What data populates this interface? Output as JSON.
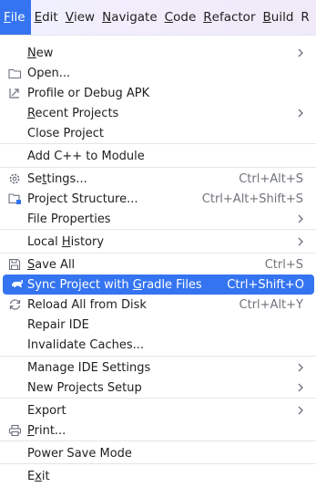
{
  "menubar": {
    "items": [
      {
        "pre": "",
        "ul": "F",
        "post": "ile"
      },
      {
        "pre": "",
        "ul": "E",
        "post": "dit"
      },
      {
        "pre": "",
        "ul": "V",
        "post": "iew"
      },
      {
        "pre": "",
        "ul": "N",
        "post": "avigate"
      },
      {
        "pre": "",
        "ul": "C",
        "post": "ode"
      },
      {
        "pre": "",
        "ul": "R",
        "post": "efactor"
      },
      {
        "pre": "",
        "ul": "B",
        "post": "uild"
      },
      {
        "pre": "",
        "ul": "R",
        "post": ""
      }
    ]
  },
  "file_menu": {
    "new": {
      "pre": "",
      "ul": "N",
      "post": "ew"
    },
    "open": {
      "pre": "",
      "ul": "",
      "post": "Open..."
    },
    "profile_debug": {
      "pre": "Profile or Debug APK",
      "ul": "",
      "post": ""
    },
    "recent_projects": {
      "pre": "",
      "ul": "R",
      "post": "ecent Projects"
    },
    "close_project": {
      "pre": "Close Project",
      "ul": "",
      "post": ""
    },
    "add_cpp": {
      "pre": "Add C++ to Module",
      "ul": "",
      "post": ""
    },
    "settings": {
      "pre": "Se",
      "ul": "t",
      "post": "tings...",
      "shortcut": "Ctrl+Alt+S"
    },
    "project_structure": {
      "pre": "Project Structure...",
      "ul": "",
      "post": "",
      "shortcut": "Ctrl+Alt+Shift+S"
    },
    "file_properties": {
      "pre": "File Properties",
      "ul": "",
      "post": ""
    },
    "local_history": {
      "pre": "Local ",
      "ul": "H",
      "post": "istory"
    },
    "save_all": {
      "pre": "",
      "ul": "S",
      "post": "ave All",
      "shortcut": "Ctrl+S"
    },
    "sync_gradle": {
      "pre": "Sync Project with ",
      "ul": "G",
      "post": "radle Files",
      "shortcut": "Ctrl+Shift+O"
    },
    "reload_disk": {
      "pre": "Reload All from Disk",
      "ul": "",
      "post": "",
      "shortcut": "Ctrl+Alt+Y"
    },
    "repair_ide": {
      "pre": "Repair IDE",
      "ul": "",
      "post": ""
    },
    "invalidate_caches": {
      "pre": "Invalidate Caches...",
      "ul": "",
      "post": ""
    },
    "manage_ide_settings": {
      "pre": "Manage IDE Settings",
      "ul": "",
      "post": ""
    },
    "new_projects_setup": {
      "pre": "New Projects Setup",
      "ul": "",
      "post": ""
    },
    "export": {
      "pre": "Export",
      "ul": "",
      "post": ""
    },
    "print": {
      "pre": "",
      "ul": "P",
      "post": "rint..."
    },
    "power_save": {
      "pre": "Power Save Mode",
      "ul": "",
      "post": ""
    },
    "exit": {
      "pre": "E",
      "ul": "x",
      "post": "it"
    }
  },
  "colors": {
    "accent": "#3574f0",
    "shortcut": "#6f737a",
    "icon": "#6c707e"
  }
}
